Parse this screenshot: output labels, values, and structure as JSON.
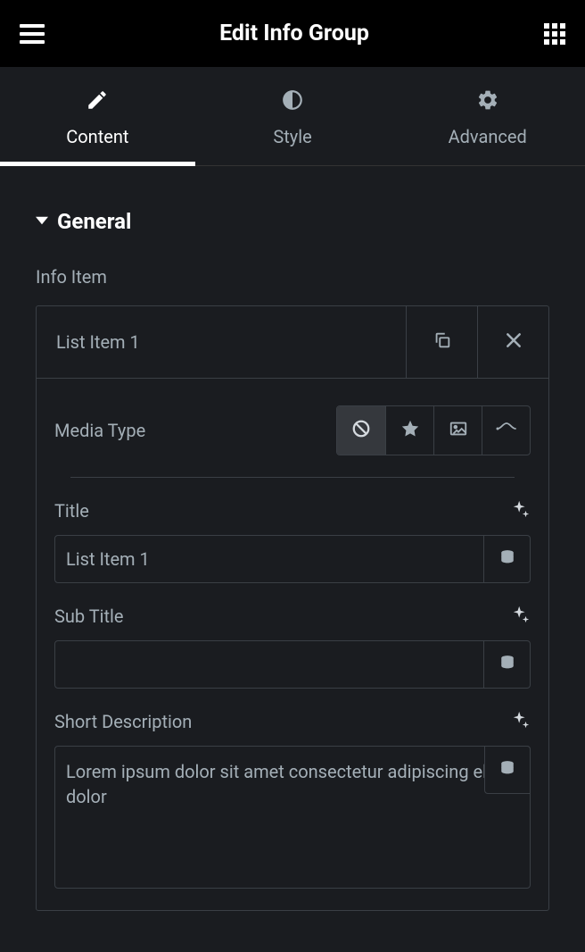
{
  "header": {
    "title": "Edit Info Group"
  },
  "tabs": {
    "content_label": "Content",
    "style_label": "Style",
    "advanced_label": "Advanced"
  },
  "section": {
    "general_label": "General"
  },
  "info_item": {
    "label": "Info Item",
    "item_title": "List Item 1"
  },
  "media_type": {
    "label": "Media Type"
  },
  "title_field": {
    "label": "Title",
    "value": "List Item 1"
  },
  "subtitle_field": {
    "label": "Sub Title",
    "value": ""
  },
  "short_description_field": {
    "label": "Short Description",
    "value": "Lorem ipsum dolor sit amet consectetur adipiscing elit dolor"
  }
}
